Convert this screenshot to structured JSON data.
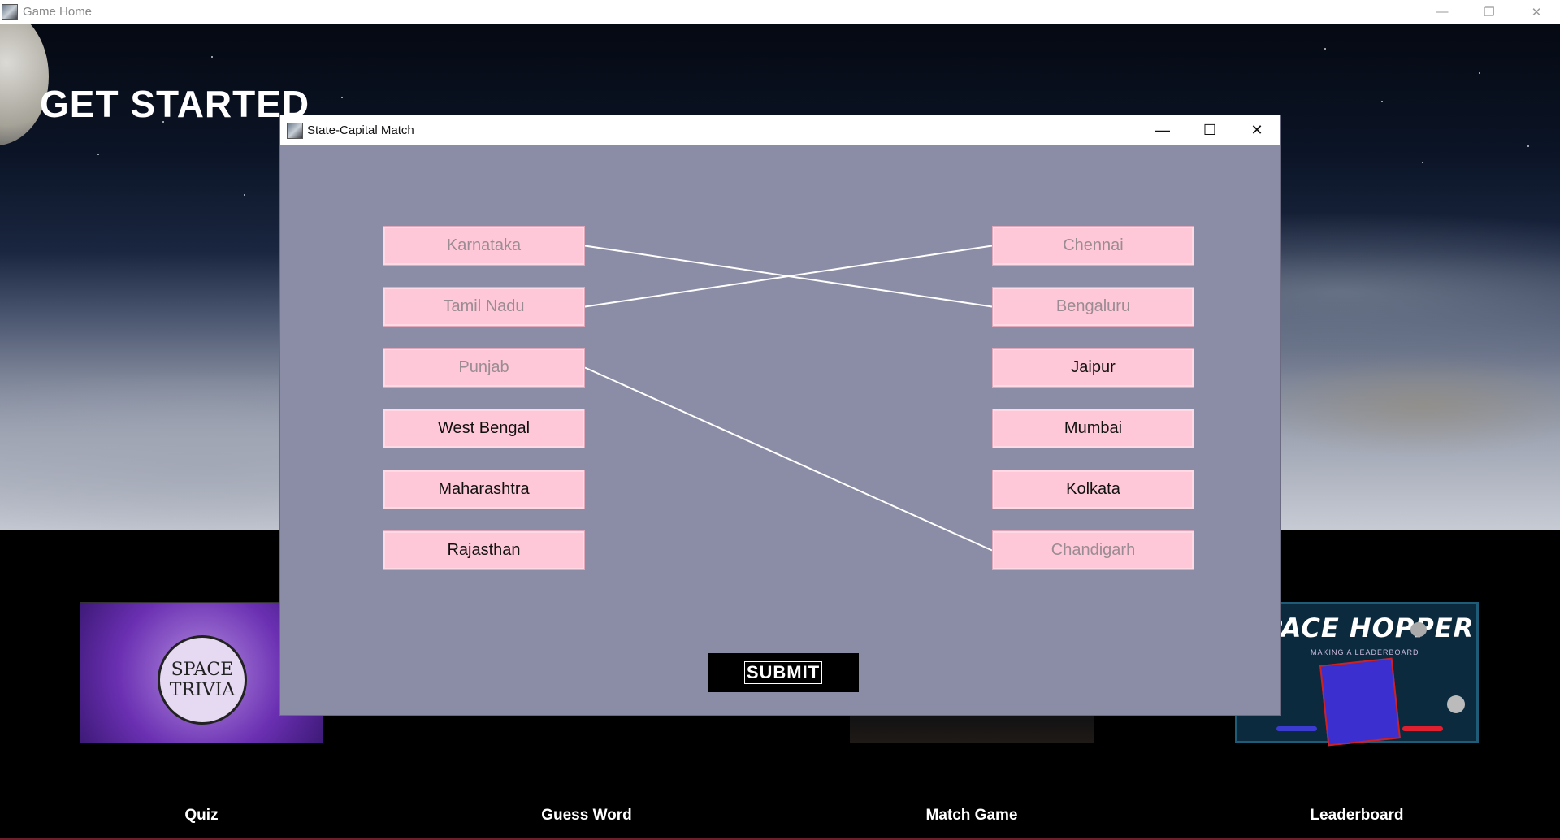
{
  "main_window": {
    "title": "Game Home",
    "controls": {
      "minimize": "—",
      "restore": "❐",
      "close": "✕"
    }
  },
  "hero": {
    "heading": "GET STARTED"
  },
  "tiles": [
    {
      "label": "Quiz",
      "image_text": [
        "SPACE",
        "TRIVIA"
      ]
    },
    {
      "label": "Guess Word"
    },
    {
      "label": "Match Game"
    },
    {
      "label": "Leaderboard",
      "image_text": "SPACE HOPPER",
      "image_subtext": "MAKING A LEADERBOARD"
    }
  ],
  "dialog": {
    "title": "State-Capital Match",
    "controls": {
      "minimize": "—",
      "maximize": "☐",
      "close": "✕"
    },
    "states": [
      {
        "label": "Karnataka",
        "matched": true
      },
      {
        "label": "Tamil Nadu",
        "matched": true
      },
      {
        "label": "Punjab",
        "matched": true
      },
      {
        "label": "West Bengal",
        "matched": false
      },
      {
        "label": "Maharashtra",
        "matched": false
      },
      {
        "label": "Rajasthan",
        "matched": false
      }
    ],
    "capitals": [
      {
        "label": "Chennai",
        "matched": true
      },
      {
        "label": "Bengaluru",
        "matched": true
      },
      {
        "label": "Jaipur",
        "matched": false
      },
      {
        "label": "Mumbai",
        "matched": false
      },
      {
        "label": "Kolkata",
        "matched": false
      },
      {
        "label": "Chandigarh",
        "matched": true
      }
    ],
    "connections": [
      {
        "state": "Karnataka",
        "capital": "Bengaluru"
      },
      {
        "state": "Tamil Nadu",
        "capital": "Chennai"
      },
      {
        "state": "Punjab",
        "capital": "Chandigarh"
      }
    ],
    "line_color": "#ffffff",
    "submit_label": "SUBMIT"
  },
  "colors": {
    "dialog_bg": "#8b8da6",
    "button_pink": "#ffc8d8",
    "matched_text": "#9a8c92"
  }
}
